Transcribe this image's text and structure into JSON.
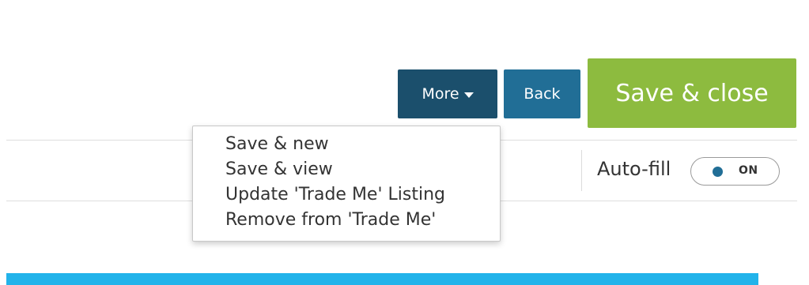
{
  "toolbar": {
    "more_label": "More",
    "back_label": "Back",
    "save_close_label": "Save & close"
  },
  "more_menu": {
    "items": [
      {
        "label": "Save & new"
      },
      {
        "label": "Save & view"
      },
      {
        "label": "Update 'Trade Me' Listing"
      },
      {
        "label": "Remove from 'Trade Me'"
      }
    ]
  },
  "autofill": {
    "label": "Auto-fill",
    "toggle_state": "ON",
    "enabled": true
  },
  "colors": {
    "more_button": "#1b4f6c",
    "back_button": "#216e96",
    "save_close_button": "#8dbb3f",
    "accent_band": "#22b3ea"
  },
  "icons": {
    "more_caret": "caret-down-icon"
  }
}
